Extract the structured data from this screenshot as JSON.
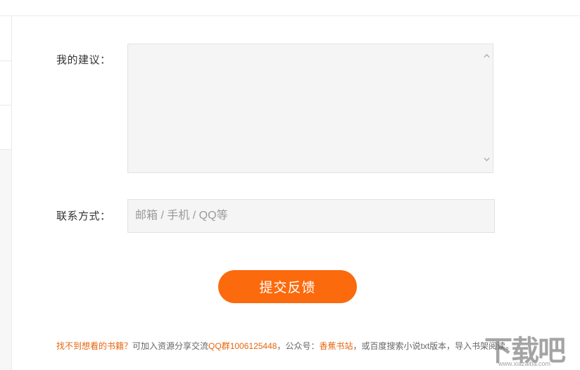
{
  "form": {
    "suggestion_label": "我的建议：",
    "suggestion_value": "",
    "contact_label": "联系方式：",
    "contact_placeholder": "邮箱 / 手机 / QQ等",
    "contact_value": "",
    "submit_label": "提交反馈"
  },
  "footer": {
    "link_text": "找不到想看的书籍？",
    "text_1": "可加入资源分享交流",
    "qq_group": "QQ群1006125448",
    "text_2": "，公众号：",
    "account": "香蕉书站",
    "text_3": "，或百度搜索小说txt版本，导入书架阅读。"
  },
  "watermark": {
    "text": "下载吧",
    "url": "www.xiazaiba.com"
  },
  "colors": {
    "accent": "#fb6a0d",
    "highlight_text": "#e7650c",
    "field_bg": "#f5f5f5"
  },
  "icons": {
    "scroll_up": "chevron-up-icon",
    "scroll_down": "chevron-down-icon"
  }
}
